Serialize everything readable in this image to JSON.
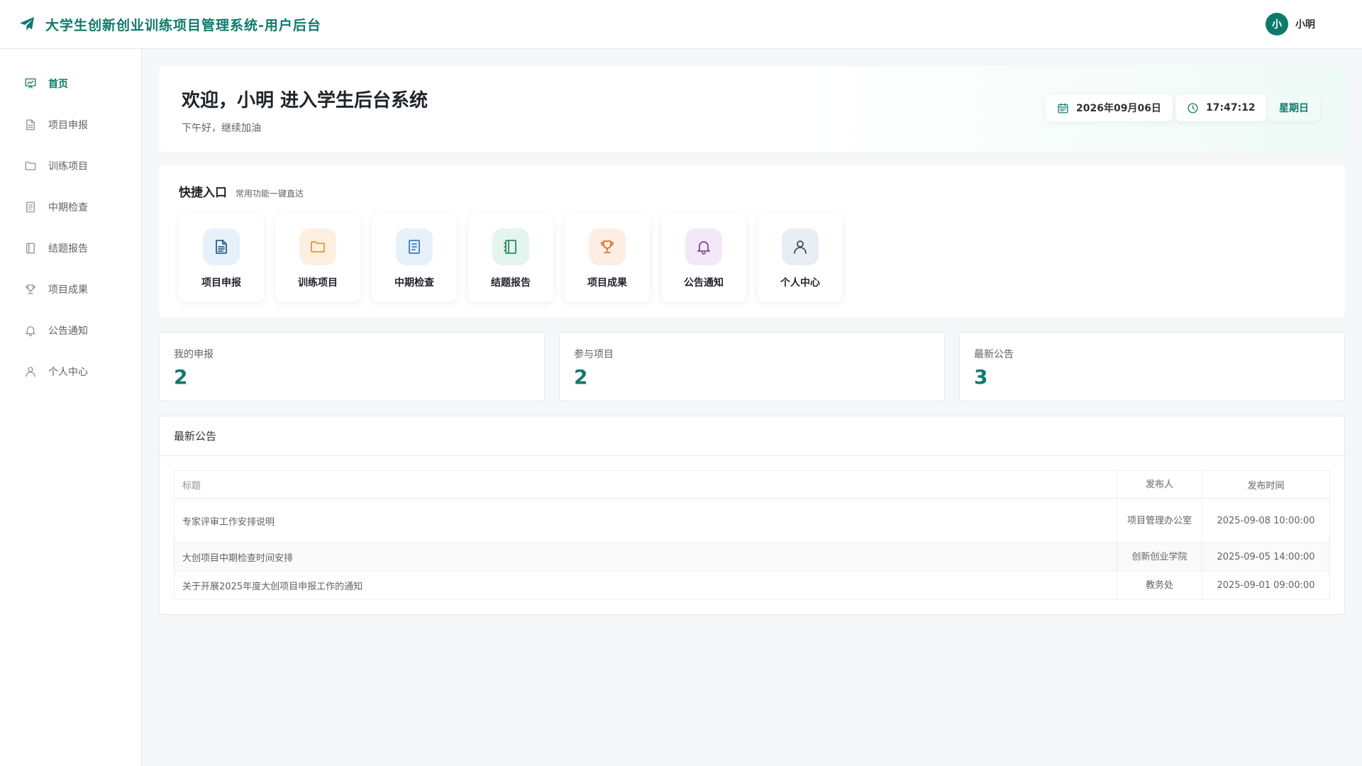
{
  "header": {
    "title": "大学生创新创业训练项目管理系统-用户后台",
    "avatar_text": "小",
    "username": "小明"
  },
  "sidebar": {
    "items": [
      {
        "label": "首页",
        "icon": "chart-board-icon",
        "active": true
      },
      {
        "label": "项目申报",
        "icon": "document-icon"
      },
      {
        "label": "训练项目",
        "icon": "folder-icon"
      },
      {
        "label": "中期检查",
        "icon": "checklist-icon"
      },
      {
        "label": "结题报告",
        "icon": "notebook-icon"
      },
      {
        "label": "项目成果",
        "icon": "trophy-icon"
      },
      {
        "label": "公告通知",
        "icon": "bell-icon"
      },
      {
        "label": "个人中心",
        "icon": "user-icon"
      }
    ]
  },
  "welcome": {
    "title": "欢迎，小明 进入学生后台系统",
    "subtitle": "下午好，继续加油",
    "date": "2026年09月06日",
    "time": "17:47:12",
    "weekday": "星期日"
  },
  "quick": {
    "title": "快捷入口",
    "subtitle": "常用功能一键直达",
    "items": [
      {
        "label": "项目申报",
        "icon": "document-icon",
        "bg": "#e6f1fb",
        "color": "#2b5d8c"
      },
      {
        "label": "训练项目",
        "icon": "folder-icon",
        "bg": "#fdf0e0",
        "color": "#e6962e"
      },
      {
        "label": "中期检查",
        "icon": "checklist-icon",
        "bg": "#e6f1fb",
        "color": "#3b7ec4"
      },
      {
        "label": "结题报告",
        "icon": "notebook-icon",
        "bg": "#e3f5ee",
        "color": "#2a8a5a"
      },
      {
        "label": "项目成果",
        "icon": "trophy-icon",
        "bg": "#fdeee4",
        "color": "#d9742a"
      },
      {
        "label": "公告通知",
        "icon": "bell-icon",
        "bg": "#f3e8f7",
        "color": "#8a3d9e"
      },
      {
        "label": "个人中心",
        "icon": "user-icon",
        "bg": "#e8eef4",
        "color": "#3d4f63"
      }
    ]
  },
  "stats": [
    {
      "label": "我的申报",
      "value": "2"
    },
    {
      "label": "参与项目",
      "value": "2"
    },
    {
      "label": "最新公告",
      "value": "3"
    }
  ],
  "notices": {
    "title": "最新公告",
    "columns": [
      "标题",
      "发布人",
      "发布时间"
    ],
    "rows": [
      {
        "title": "专家评审工作安排说明",
        "publisher": "项目管理办公室",
        "time": "2025-09-08 10:00:00"
      },
      {
        "title": "大创项目中期检查时间安排",
        "publisher": "创新创业学院",
        "time": "2025-09-05 14:00:00"
      },
      {
        "title": "关于开展2025年度大创项目申报工作的通知",
        "publisher": "教务处",
        "time": "2025-09-01 09:00:00"
      }
    ]
  },
  "colors": {
    "primary": "#0f7a6c",
    "background": "#f6f7f9"
  }
}
